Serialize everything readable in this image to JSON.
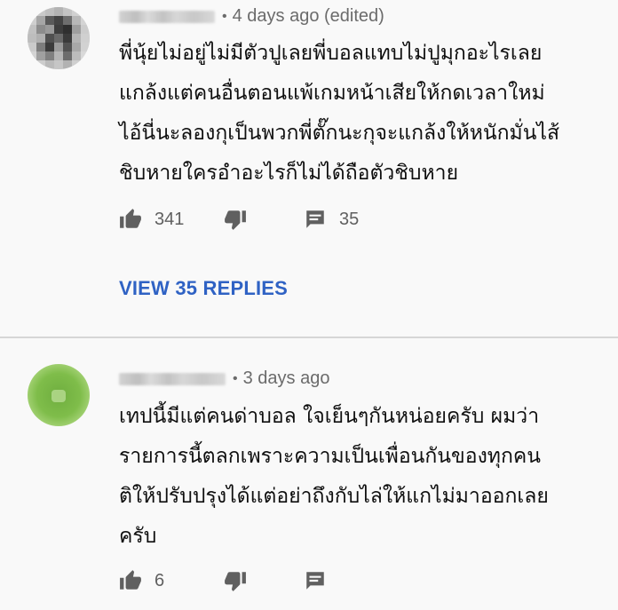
{
  "comments": [
    {
      "timestamp": "4 days ago (edited)",
      "lines": [
        "พี่นุ้ยไม่อยู่ไม่มีตัวปูเลยพี่บอลแทบไม่ปูมุกอะไรเลย",
        "แกล้งแต่คนอื่นตอนแพ้เกมหน้าเสียให้กดเวลาใหม่",
        "ไอ้นี่นะลองกุเป็นพวกพี่ตั๊กนะกุจะแกล้งให้หนักมั่นไส้",
        "ชิบหายใครอำอะไรก็ไม่ได้ถือตัวชิบหาย"
      ],
      "likes": "341",
      "replies_count": "35",
      "view_replies_label": "VIEW 35 REPLIES",
      "avatar_icon": "blurred-avatar-icon"
    },
    {
      "timestamp": "3 days ago",
      "lines": [
        "เทปนี้มีแต่คนด่าบอล ใจเย็นๆกันหน่อยครับ ผมว่า",
        "รายการนี้ตลกเพราะความเป็นเพื่อนกันของทุกคน",
        "ติให้ปรับปรุงได้แต่อย่าถึงกับไล่ให้แกไม่มาออกเลย",
        "ครับ"
      ],
      "likes": "6",
      "avatar_icon": "green-avatar-icon"
    }
  ],
  "colors": {
    "background": "#f9f9f9",
    "link": "#2f62c4",
    "meta_text": "#6b6b6b",
    "icon": "#606060",
    "avatar_green": "#7cb342"
  },
  "icons": {
    "like": "thumbs-up-icon",
    "dislike": "thumbs-down-icon",
    "reply": "comment-icon"
  }
}
